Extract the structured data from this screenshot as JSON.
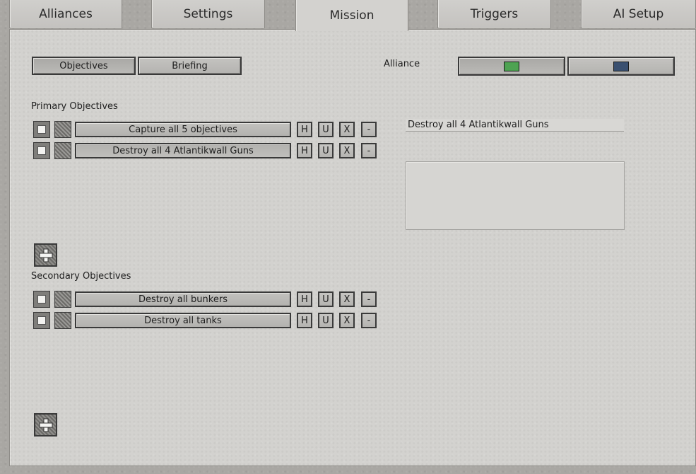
{
  "tabs": [
    {
      "label": "Alliances",
      "active": false
    },
    {
      "label": "Settings",
      "active": false
    },
    {
      "label": "Mission",
      "active": true
    },
    {
      "label": "Triggers",
      "active": false
    },
    {
      "label": "AI Setup",
      "active": false
    }
  ],
  "subtabs": {
    "objectives": "Objectives",
    "briefing": "Briefing",
    "selected": "Objectives"
  },
  "alliance": {
    "label": "Alliance",
    "options": [
      {
        "color": "#4ea352",
        "selected": true
      },
      {
        "color": "#3a5070",
        "selected": false
      }
    ]
  },
  "primary": {
    "heading": "Primary Objectives",
    "items": [
      {
        "text": "Capture all 5 objectives"
      },
      {
        "text": "Destroy all 4 Atlantikwall Guns"
      }
    ]
  },
  "secondary": {
    "heading": "Secondary Objectives",
    "items": [
      {
        "text": "Destroy all bunkers"
      },
      {
        "text": "Destroy all tanks"
      }
    ]
  },
  "row_buttons": {
    "h": "H",
    "u": "U",
    "x": "X",
    "minus": "-"
  },
  "detail": {
    "title_value": "Destroy all 4 Atlantikwall Guns",
    "body_value": ""
  }
}
